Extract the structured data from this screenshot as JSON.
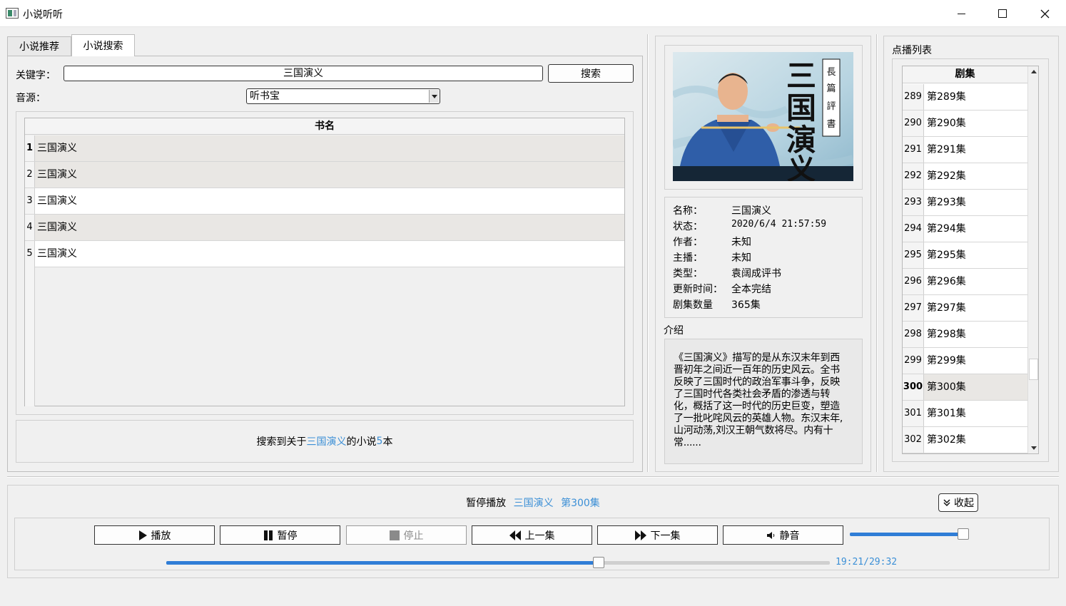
{
  "window": {
    "title": "小说听听"
  },
  "tabs": [
    {
      "label": "小说推荐",
      "active": false
    },
    {
      "label": "小说搜索",
      "active": true
    }
  ],
  "search": {
    "keyword_label": "关键字：",
    "keyword_value": "三国演义",
    "button_label": "搜索",
    "source_label": "音源：",
    "source_value": "听书宝"
  },
  "results": {
    "column_header": "书名",
    "rows": [
      {
        "num": "1",
        "name": "三国演义"
      },
      {
        "num": "2",
        "name": "三国演义"
      },
      {
        "num": "3",
        "name": "三国演义"
      },
      {
        "num": "4",
        "name": "三国演义"
      },
      {
        "num": "5",
        "name": "三国演义"
      }
    ],
    "status_prefix": "搜索到关于",
    "status_keyword": "三国演义",
    "status_middle": "的小说",
    "status_count": "5",
    "status_suffix": "本"
  },
  "book": {
    "cover_title": "三国演义",
    "cover_subtitle": "長篇評書",
    "fields": [
      {
        "key": "名称：",
        "value": "三国演义"
      },
      {
        "key": "状态：",
        "value": "2020/6/4 21:57:59"
      },
      {
        "key": "作者：",
        "value": "未知"
      },
      {
        "key": "主播：",
        "value": "未知"
      },
      {
        "key": "类型：",
        "value": "袁阔成评书"
      },
      {
        "key": "更新时间：",
        "value": "全本完结"
      },
      {
        "key": "剧集数量",
        "value": "365集"
      }
    ],
    "intro_label": "介绍",
    "intro_text": "《三国演义》描写的是从东汉末年到西晋初年之间近一百年的历史风云。全书反映了三国时代的政治军事斗争，反映了三国时代各类社会矛盾的渗透与转化，概括了这一时代的历史巨变，塑造了一批叱咤风云的英雄人物。东汉末年,山河动荡,刘汉王朝气数将尽。内有十常......"
  },
  "episodes": {
    "title": "点播列表",
    "column_header": "剧集",
    "rows": [
      {
        "num": "289",
        "name": "第289集"
      },
      {
        "num": "290",
        "name": "第290集"
      },
      {
        "num": "291",
        "name": "第291集"
      },
      {
        "num": "292",
        "name": "第292集"
      },
      {
        "num": "293",
        "name": "第293集"
      },
      {
        "num": "294",
        "name": "第294集"
      },
      {
        "num": "295",
        "name": "第295集"
      },
      {
        "num": "296",
        "name": "第296集"
      },
      {
        "num": "297",
        "name": "第297集"
      },
      {
        "num": "298",
        "name": "第298集"
      },
      {
        "num": "299",
        "name": "第299集"
      },
      {
        "num": "300",
        "name": "第300集",
        "selected": true
      },
      {
        "num": "301",
        "name": "第301集"
      },
      {
        "num": "302",
        "name": "第302集"
      }
    ]
  },
  "player": {
    "state": "暂停播放",
    "book": "三国演义",
    "episode": "第300集",
    "collapse_label": "收起",
    "buttons": {
      "play": "播放",
      "pause": "暂停",
      "stop": "停止",
      "prev": "上一集",
      "next": "下一集",
      "mute": "静音"
    },
    "volume_fraction": 1.0,
    "progress_fraction": 0.654,
    "time": "19:21/29:32",
    "accent_color": "#2f7dd6",
    "highlight_color": "#3b8fd6"
  }
}
